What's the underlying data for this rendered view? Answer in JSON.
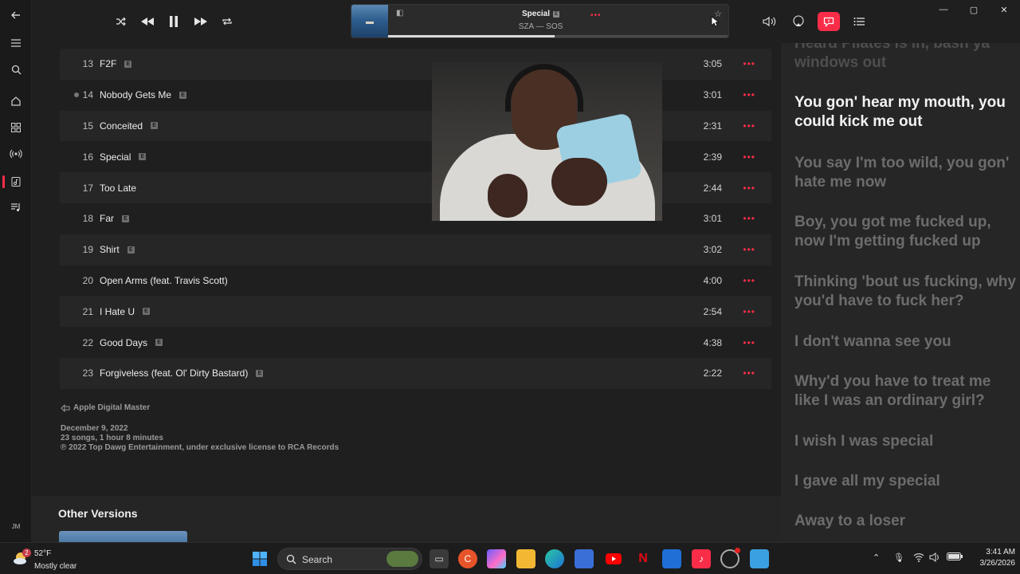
{
  "now_playing": {
    "title": "Special",
    "explicit_badge": "E",
    "subtitle": "SZA — SOS",
    "progress": 0.49
  },
  "player_controls": [
    "shuffle-icon",
    "previous-icon",
    "pause-icon",
    "next-icon",
    "repeat-icon"
  ],
  "tracks": [
    {
      "num": "13",
      "title": "F2F",
      "explicit": true,
      "duration": "3:05"
    },
    {
      "num": "14",
      "title": "Nobody Gets Me",
      "explicit": true,
      "duration": "3:01"
    },
    {
      "num": "15",
      "title": "Conceited",
      "explicit": true,
      "duration": "2:31"
    },
    {
      "num": "16",
      "title": "Special",
      "explicit": true,
      "duration": "2:39"
    },
    {
      "num": "17",
      "title": "Too Late",
      "explicit": false,
      "duration": "2:44"
    },
    {
      "num": "18",
      "title": "Far",
      "explicit": true,
      "duration": "3:01"
    },
    {
      "num": "19",
      "title": "Shirt",
      "explicit": true,
      "duration": "3:02"
    },
    {
      "num": "20",
      "title": "Open Arms (feat. Travis Scott)",
      "explicit": false,
      "duration": "4:00"
    },
    {
      "num": "21",
      "title": "I Hate U",
      "explicit": true,
      "duration": "2:54"
    },
    {
      "num": "22",
      "title": "Good Days",
      "explicit": true,
      "duration": "4:38"
    },
    {
      "num": "23",
      "title": "Forgiveless (feat. Ol' Dirty Bastard)",
      "explicit": true,
      "duration": "2:22"
    }
  ],
  "album_info": {
    "digital_master": "Apple Digital Master",
    "release_date": "December 9, 2022",
    "summary": "23 songs, 1 hour 8 minutes",
    "copyright": "℗ 2022 Top Dawg Entertainment, under exclusive license to RCA Records"
  },
  "other_versions": {
    "title": "Other Versions"
  },
  "lyrics": [
    "Heard Pilates is in, bash ya windows out",
    "You gon' hear my mouth, you could kick me out",
    "You say I'm too wild, you gon' hate me now",
    "Boy, you got me fucked up, now I'm getting fucked up",
    "Thinking 'bout us fucking, why you'd have to fuck her?",
    "I don't wanna see you",
    "Why'd you have to treat me like I was an ordinary girl?",
    "I wish I was special",
    "I gave all my special",
    "Away to a loser"
  ],
  "user_initials": "JM",
  "taskbar": {
    "weather_temp": "52°F",
    "weather_cond": "Mostly clear",
    "weather_badge": "2",
    "search_label": "Search",
    "time": "3:41 AM",
    "date": "3/26/2026"
  },
  "colors": {
    "accent": "#fa2d48",
    "background": "#1f1f1f",
    "lyrics_panel": "#262626"
  }
}
